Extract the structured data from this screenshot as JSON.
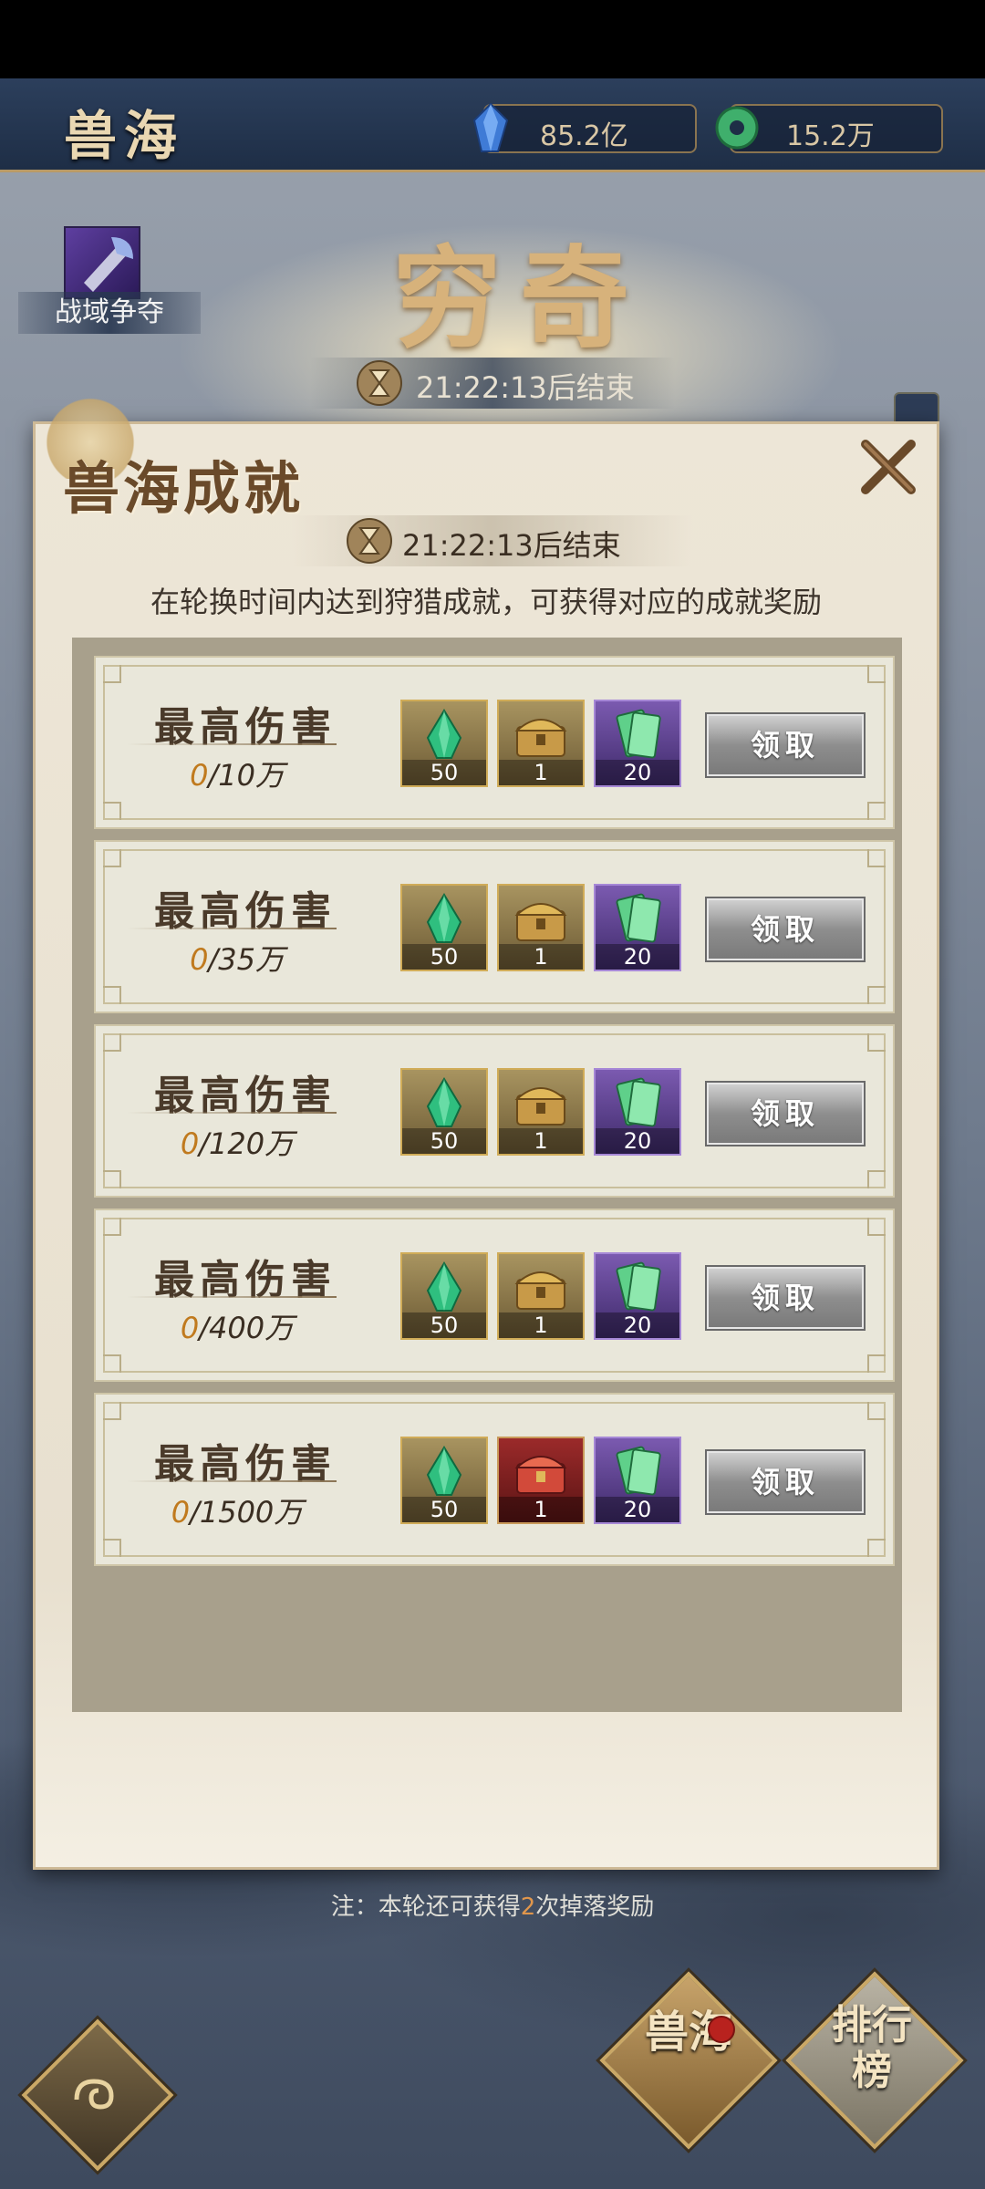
{
  "header": {
    "title": "兽海",
    "resources": [
      {
        "icon": "blue-crystal-icon",
        "value": "85.2亿"
      },
      {
        "icon": "jade-coin-icon",
        "value": "15.2万"
      }
    ]
  },
  "event": {
    "label": "战域争夺",
    "boss_name": "穷奇",
    "timer": "21:22:13后结束"
  },
  "modal": {
    "title": "兽海成就",
    "timer": "21:22:13后结束",
    "description": "在轮换时间内达到狩猎成就，可获得对应的成就奖励",
    "achievements": [
      {
        "title": "最高伤害",
        "current": "0",
        "target": "/10万",
        "rewards": [
          {
            "icon": "green-crystal-icon",
            "count": "50"
          },
          {
            "icon": "gold-chest-icon",
            "count": "1"
          },
          {
            "icon": "green-talisman-icon",
            "count": "20"
          }
        ],
        "button": "领取"
      },
      {
        "title": "最高伤害",
        "current": "0",
        "target": "/35万",
        "rewards": [
          {
            "icon": "green-crystal-icon",
            "count": "50"
          },
          {
            "icon": "gold-chest-icon",
            "count": "1"
          },
          {
            "icon": "green-talisman-icon",
            "count": "20"
          }
        ],
        "button": "领取"
      },
      {
        "title": "最高伤害",
        "current": "0",
        "target": "/120万",
        "rewards": [
          {
            "icon": "green-crystal-icon",
            "count": "50"
          },
          {
            "icon": "gold-chest-icon",
            "count": "1"
          },
          {
            "icon": "green-talisman-icon",
            "count": "20"
          }
        ],
        "button": "领取"
      },
      {
        "title": "最高伤害",
        "current": "0",
        "target": "/400万",
        "rewards": [
          {
            "icon": "green-crystal-icon",
            "count": "50"
          },
          {
            "icon": "gold-chest-icon",
            "count": "1"
          },
          {
            "icon": "green-talisman-icon",
            "count": "20"
          }
        ],
        "button": "领取"
      },
      {
        "title": "最高伤害",
        "current": "0",
        "target": "/1500万",
        "rewards": [
          {
            "icon": "green-crystal-icon",
            "count": "50"
          },
          {
            "icon": "red-chest-icon",
            "count": "1"
          },
          {
            "icon": "green-talisman-icon",
            "count": "20"
          }
        ],
        "button": "领取"
      }
    ]
  },
  "note": {
    "prefix": "注：本轮还可获得",
    "count": "2",
    "suffix": "次掉落奖励"
  },
  "bottom": {
    "beast_sea_label": "兽海",
    "ranking_label": "排行榜"
  },
  "colors": {
    "accent_gold": "#d0ac58",
    "progress_highlight": "#c07a1e",
    "note_highlight": "#e0964c"
  }
}
